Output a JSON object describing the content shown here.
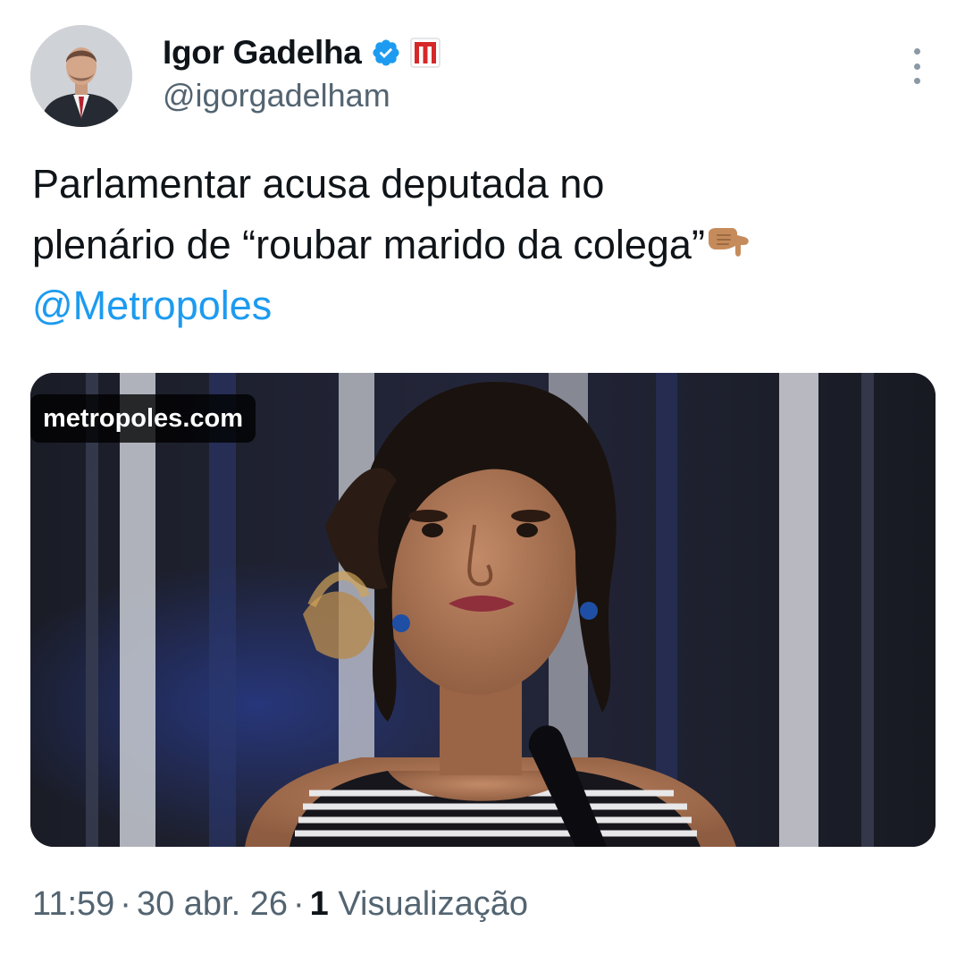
{
  "author": {
    "display_name": "Igor Gadelha",
    "handle": "@igorgadelham",
    "verified_icon": "verified-badge-icon",
    "affiliation_icon": "metropoles-logo-icon",
    "accent_color": "#1d9bf0"
  },
  "tweet": {
    "text_line_1": "Parlamentar acusa deputada no",
    "text_line_2": "plenário de “roubar marido da colega”",
    "emoji": "backhand-index-pointing-down-emoji",
    "mention": "@Metropoles"
  },
  "media": {
    "source_label": "metropoles.com"
  },
  "meta": {
    "time": "11:59",
    "date": "30 abr. 26",
    "views_count": "1",
    "views_label": "Visualização"
  }
}
